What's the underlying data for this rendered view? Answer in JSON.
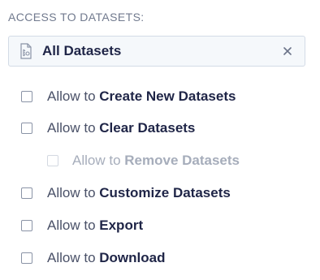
{
  "section": {
    "title": "ACCESS TO DATASETS:"
  },
  "selector": {
    "value": "All Datasets",
    "icon": "dataset-icon",
    "clear_icon": "close-icon"
  },
  "permissions": [
    {
      "prefix": "Allow to",
      "action": "Create New Datasets",
      "checked": false,
      "disabled": false
    },
    {
      "prefix": "Allow to",
      "action": "Clear Datasets",
      "checked": false,
      "disabled": false
    },
    {
      "prefix": "Allow to",
      "action": "Remove Datasets",
      "checked": false,
      "disabled": true
    },
    {
      "prefix": "Allow to",
      "action": "Customize Datasets",
      "checked": false,
      "disabled": false
    },
    {
      "prefix": "Allow to",
      "action": "Export",
      "checked": false,
      "disabled": false
    },
    {
      "prefix": "Allow to",
      "action": "Download",
      "checked": false,
      "disabled": false
    }
  ]
}
